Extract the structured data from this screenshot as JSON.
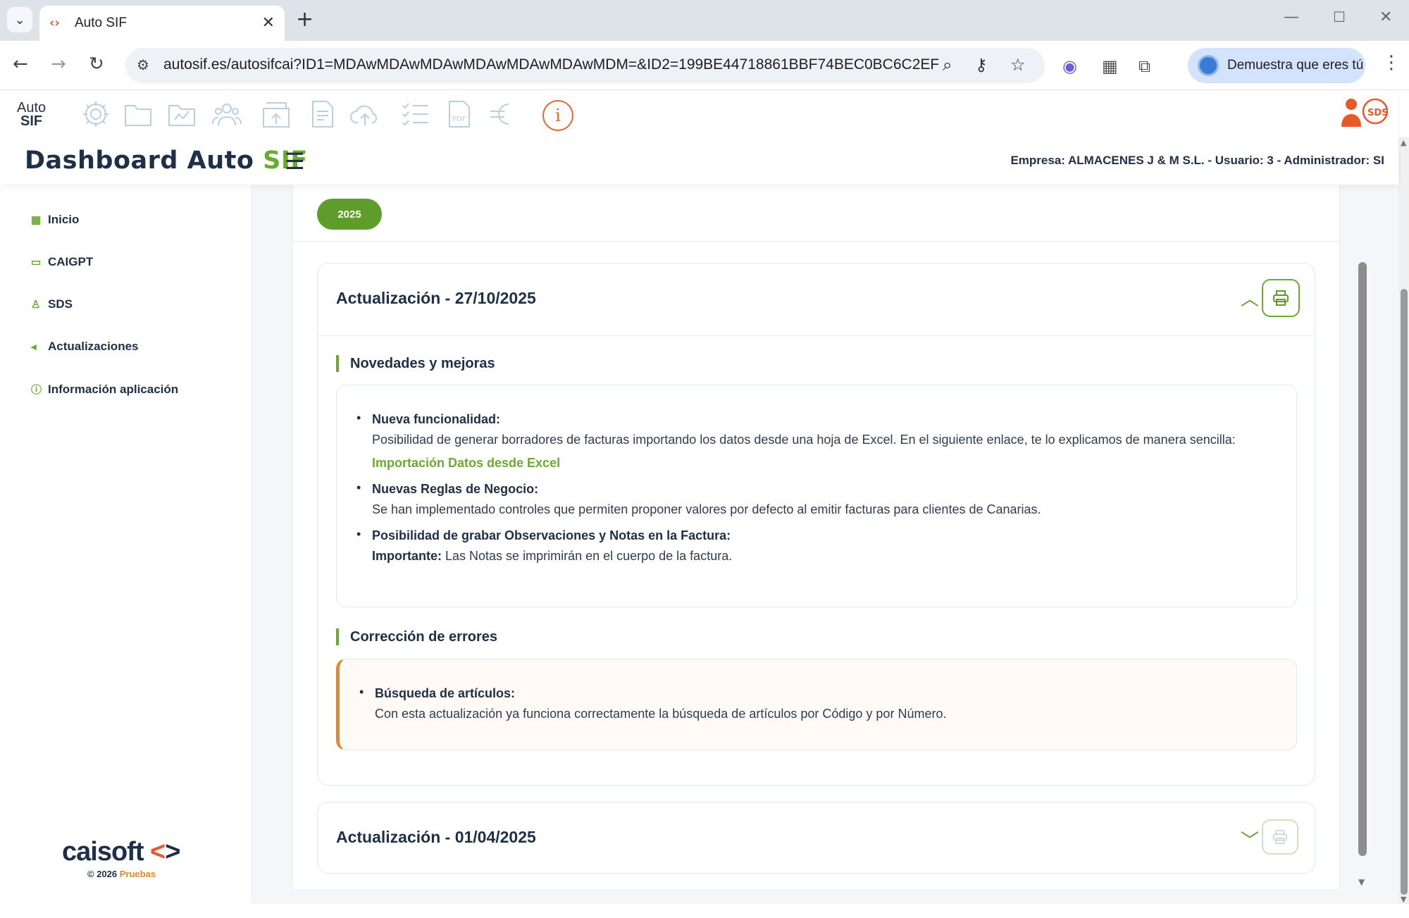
{
  "browser": {
    "tab_title": "Auto SIF",
    "url": "autosif.es/autosifcai?ID1=MDAwMDAwMDAwMDAwMDAwMDAwMDM=&ID2=199BE44718861BBF74BEC0BC6C2EF...",
    "profile_label": "Demuestra que eres tú"
  },
  "header": {
    "logo_line1": "Auto",
    "logo_line2": "SIF",
    "title_main": "Dashboard Auto ",
    "title_accent": "SIF",
    "company_info": "Empresa: ALMACENES J & M S.L. - Usuario: 3 - Administrador: SI",
    "info_glyph": "i",
    "tool_icons": [
      "gear-icon",
      "folder-icon",
      "map-folder-icon",
      "users-icon",
      "archive-upload-icon",
      "document-icon",
      "cloud-upload-icon",
      "checklist-icon",
      "pdf-icon",
      "euro-icon"
    ]
  },
  "sidebar": {
    "items": [
      {
        "label": "Inicio",
        "icon": "grid-icon"
      },
      {
        "label": "CAIGPT",
        "icon": "chat-icon"
      },
      {
        "label": "SDS",
        "icon": "user-icon"
      },
      {
        "label": "Actualizaciones",
        "icon": "megaphone-icon"
      },
      {
        "label": "Información aplicación",
        "icon": "info-icon"
      }
    ],
    "brand_name": "caisoft",
    "brand_copy": "© 2026",
    "brand_env": "Pruebas"
  },
  "main": {
    "year": "2025",
    "updates": [
      {
        "title": "Actualización - 27/10/2025",
        "expanded": true,
        "sections": {
          "news_label": "Novedades y mejoras",
          "news": [
            {
              "head": "Nueva funcionalidad:",
              "text": "Posibilidad de generar borradores de facturas importando los datos desde una hoja de Excel. En el siguiente enlace, te lo explicamos de manera sencilla:",
              "link": "Importación Datos desde Excel"
            },
            {
              "head": "Nuevas Reglas de Negocio:",
              "text": "Se han implementado controles que permiten proponer valores por defecto al emitir facturas para clientes de Canarias."
            },
            {
              "head": "Posibilidad de grabar Observaciones y Notas en la Factura:",
              "strong": "Importante:",
              "text": "Las Notas se imprimirán en el cuerpo de la factura."
            }
          ],
          "fixes_label": "Corrección de errores",
          "fixes": [
            {
              "head": "Búsqueda de artículos:",
              "text": "Con esta actualización ya funciona correctamente la búsqueda de artículos por Código y por Número."
            }
          ]
        }
      },
      {
        "title": "Actualización - 01/04/2025",
        "expanded": false
      }
    ]
  },
  "colors": {
    "accent_green": "#6aac2e",
    "navy": "#1e2f48",
    "orange": "#e8582b"
  }
}
